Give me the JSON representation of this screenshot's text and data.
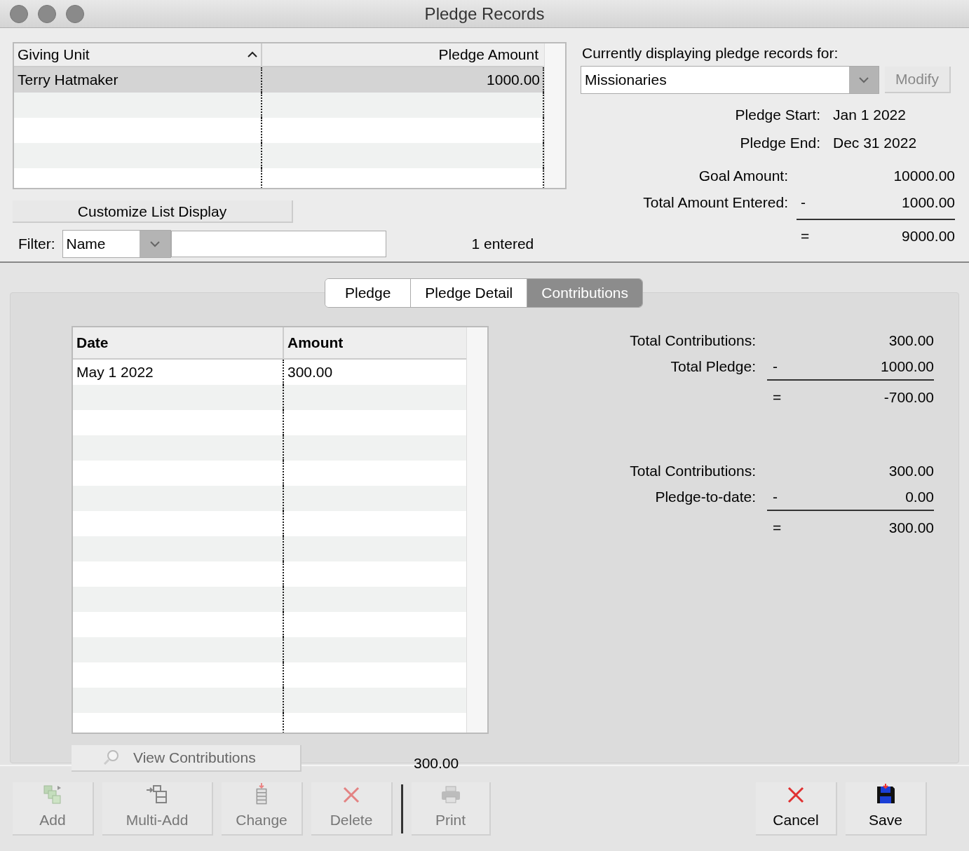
{
  "window": {
    "title": "Pledge Records"
  },
  "pledge_list": {
    "columns": [
      {
        "label": "Giving Unit",
        "sorted": true
      },
      {
        "label": "Pledge Amount",
        "sorted": false
      }
    ],
    "rows": [
      {
        "giving_unit": "Terry Hatmaker",
        "pledge_amount": "1000.00",
        "selected": true
      }
    ]
  },
  "customize_button": "Customize List Display",
  "filter": {
    "label": "Filter:",
    "field": "Name"
  },
  "entered_count": "1 entered",
  "display_for": {
    "label": "Currently displaying pledge records for:",
    "value": "Missionaries",
    "modify": {
      "label": "Modify",
      "disabled": true
    }
  },
  "dates": [
    {
      "label": "Pledge Start:",
      "value": "Jan 1 2022"
    },
    {
      "label": "Pledge End:",
      "value": "Dec 31 2022"
    }
  ],
  "summary": {
    "lines": [
      {
        "label": "Goal Amount:",
        "value": "10000.00"
      },
      {
        "label": "Total Amount Entered:",
        "op": "-",
        "value": "1000.00"
      }
    ],
    "result_op": "=",
    "result": "9000.00"
  },
  "tabs": [
    {
      "label": "Pledge",
      "selected": false
    },
    {
      "label": "Pledge Detail",
      "selected": false
    },
    {
      "label": "Contributions",
      "selected": true
    }
  ],
  "contributions": {
    "columns": [
      "Date",
      "Amount"
    ],
    "rows": [
      {
        "date": "May 1 2022",
        "amount": "300.00"
      }
    ],
    "view_button": {
      "label": "View Contributions",
      "disabled": true
    },
    "total": "300.00"
  },
  "calculations": [
    {
      "lines": [
        {
          "label": "Total Contributions:",
          "value": "300.00"
        },
        {
          "label": "Total Pledge:",
          "op": "-",
          "value": "1000.00"
        }
      ],
      "result_op": "=",
      "result": "-700.00"
    },
    {
      "lines": [
        {
          "label": "Total Contributions:",
          "value": "300.00"
        },
        {
          "label": "Pledge-to-date:",
          "op": "-",
          "value": "0.00"
        }
      ],
      "result_op": "=",
      "result": "300.00"
    }
  ],
  "toolbar": {
    "left": [
      {
        "kind": "add",
        "label": "Add",
        "disabled": true
      },
      {
        "kind": "multi_add",
        "label": "Multi-Add",
        "disabled": true
      },
      {
        "kind": "change",
        "label": "Change",
        "disabled": true
      },
      {
        "kind": "delete",
        "label": "Delete",
        "disabled": true
      },
      {
        "kind": "print",
        "label": "Print",
        "disabled": true
      }
    ],
    "right": [
      {
        "kind": "cancel",
        "label": "Cancel",
        "disabled": false
      },
      {
        "kind": "save",
        "label": "Save",
        "disabled": false
      }
    ]
  }
}
